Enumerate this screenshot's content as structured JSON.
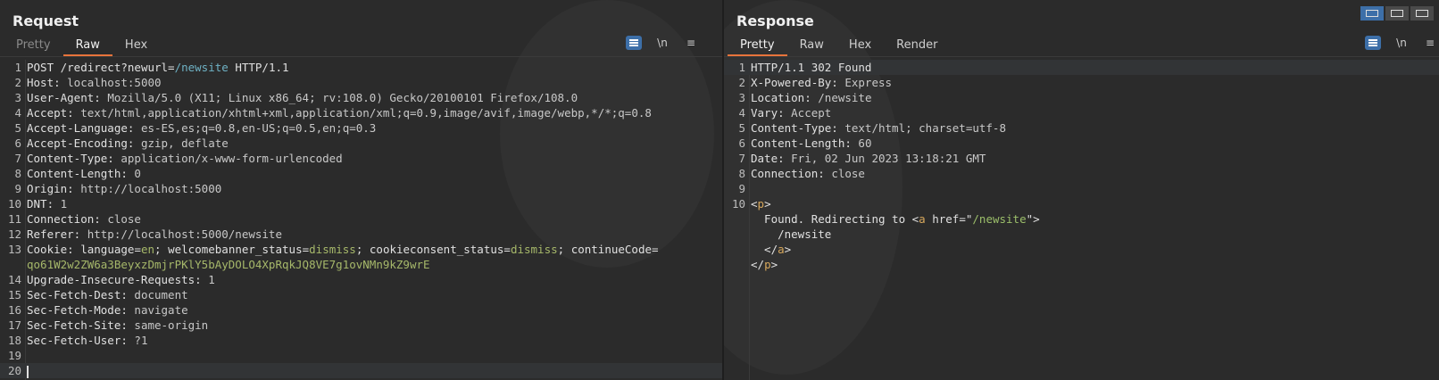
{
  "request": {
    "title": "Request",
    "tabs": [
      "Pretty",
      "Raw",
      "Hex"
    ],
    "active_tab": "Raw",
    "tools": {
      "newline_label": "\\n",
      "menu_label": "≡"
    },
    "lines": [
      {
        "n": "1",
        "parts": [
          {
            "t": "POST /redirect?",
            "c": "k"
          },
          {
            "t": "newurl",
            "c": "k"
          },
          {
            "t": "=",
            "c": "k"
          },
          {
            "t": "/newsite",
            "c": "p"
          },
          {
            "t": " HTTP/1.1",
            "c": "k"
          }
        ]
      },
      {
        "n": "2",
        "parts": [
          {
            "t": "Host: ",
            "c": "k"
          },
          {
            "t": "localhost:5000",
            "c": "v"
          }
        ]
      },
      {
        "n": "3",
        "parts": [
          {
            "t": "User-Agent: ",
            "c": "k"
          },
          {
            "t": "Mozilla/5.0 (X11; Linux x86_64; rv:108.0) Gecko/20100101 Firefox/108.0",
            "c": "v"
          }
        ]
      },
      {
        "n": "4",
        "parts": [
          {
            "t": "Accept: ",
            "c": "k"
          },
          {
            "t": "text/html,application/xhtml+xml,application/xml;q=0.9,image/avif,image/webp,*/*;q=0.8",
            "c": "v"
          }
        ]
      },
      {
        "n": "5",
        "parts": [
          {
            "t": "Accept-Language: ",
            "c": "k"
          },
          {
            "t": "es-ES,es;q=0.8,en-US;q=0.5,en;q=0.3",
            "c": "v"
          }
        ]
      },
      {
        "n": "6",
        "parts": [
          {
            "t": "Accept-Encoding: ",
            "c": "k"
          },
          {
            "t": "gzip, deflate",
            "c": "v"
          }
        ]
      },
      {
        "n": "7",
        "parts": [
          {
            "t": "Content-Type: ",
            "c": "k"
          },
          {
            "t": "application/x-www-form-urlencoded",
            "c": "v"
          }
        ]
      },
      {
        "n": "8",
        "parts": [
          {
            "t": "Content-Length: ",
            "c": "k"
          },
          {
            "t": "0",
            "c": "v"
          }
        ]
      },
      {
        "n": "9",
        "parts": [
          {
            "t": "Origin: ",
            "c": "k"
          },
          {
            "t": "http://localhost:5000",
            "c": "v"
          }
        ]
      },
      {
        "n": "10",
        "parts": [
          {
            "t": "DNT: ",
            "c": "k"
          },
          {
            "t": "1",
            "c": "v"
          }
        ]
      },
      {
        "n": "11",
        "parts": [
          {
            "t": "Connection: ",
            "c": "k"
          },
          {
            "t": "close",
            "c": "v"
          }
        ]
      },
      {
        "n": "12",
        "parts": [
          {
            "t": "Referer: ",
            "c": "k"
          },
          {
            "t": "http://localhost:5000/newsite",
            "c": "v"
          }
        ]
      },
      {
        "n": "13",
        "parts": [
          {
            "t": "Cookie: ",
            "c": "k"
          },
          {
            "t": "language",
            "c": "k"
          },
          {
            "t": "=",
            "c": "k"
          },
          {
            "t": "en",
            "c": "g"
          },
          {
            "t": "; ",
            "c": "k"
          },
          {
            "t": "welcomebanner_status",
            "c": "k"
          },
          {
            "t": "=",
            "c": "k"
          },
          {
            "t": "dismiss",
            "c": "g"
          },
          {
            "t": "; ",
            "c": "k"
          },
          {
            "t": "cookieconsent_status",
            "c": "k"
          },
          {
            "t": "=",
            "c": "k"
          },
          {
            "t": "dismiss",
            "c": "g"
          },
          {
            "t": "; ",
            "c": "k"
          },
          {
            "t": "continueCode",
            "c": "k"
          },
          {
            "t": "=",
            "c": "k"
          }
        ]
      },
      {
        "n": "",
        "parts": [
          {
            "t": "qo61W2w2ZW6a3BeyxzDmjrPKlY5bAyDOLO4XpRqkJQ8VE7g1ovNMn9kZ9wrE",
            "c": "g"
          }
        ]
      },
      {
        "n": "14",
        "parts": [
          {
            "t": "Upgrade-Insecure-Requests: ",
            "c": "k"
          },
          {
            "t": "1",
            "c": "v"
          }
        ]
      },
      {
        "n": "15",
        "parts": [
          {
            "t": "Sec-Fetch-Dest: ",
            "c": "k"
          },
          {
            "t": "document",
            "c": "v"
          }
        ]
      },
      {
        "n": "16",
        "parts": [
          {
            "t": "Sec-Fetch-Mode: ",
            "c": "k"
          },
          {
            "t": "navigate",
            "c": "v"
          }
        ]
      },
      {
        "n": "17",
        "parts": [
          {
            "t": "Sec-Fetch-Site: ",
            "c": "k"
          },
          {
            "t": "same-origin",
            "c": "v"
          }
        ]
      },
      {
        "n": "18",
        "parts": [
          {
            "t": "Sec-Fetch-User: ",
            "c": "k"
          },
          {
            "t": "?1",
            "c": "v"
          }
        ]
      },
      {
        "n": "19",
        "parts": []
      },
      {
        "n": "20",
        "parts": [],
        "cursor": true
      }
    ]
  },
  "response": {
    "title": "Response",
    "tabs": [
      "Pretty",
      "Raw",
      "Hex",
      "Render"
    ],
    "active_tab": "Pretty",
    "tools": {
      "newline_label": "\\n",
      "menu_label": "≡"
    },
    "lines": [
      {
        "n": "1",
        "parts": [
          {
            "t": "HTTP/1.1 302 Found",
            "c": "k"
          }
        ]
      },
      {
        "n": "2",
        "parts": [
          {
            "t": "X-Powered-By: ",
            "c": "k"
          },
          {
            "t": "Express",
            "c": "v"
          }
        ]
      },
      {
        "n": "3",
        "parts": [
          {
            "t": "Location: ",
            "c": "k"
          },
          {
            "t": "/newsite",
            "c": "v"
          }
        ]
      },
      {
        "n": "4",
        "parts": [
          {
            "t": "Vary: ",
            "c": "k"
          },
          {
            "t": "Accept",
            "c": "v"
          }
        ]
      },
      {
        "n": "5",
        "parts": [
          {
            "t": "Content-Type: ",
            "c": "k"
          },
          {
            "t": "text/html; charset=utf-8",
            "c": "v"
          }
        ]
      },
      {
        "n": "6",
        "parts": [
          {
            "t": "Content-Length: ",
            "c": "k"
          },
          {
            "t": "60",
            "c": "v"
          }
        ]
      },
      {
        "n": "7",
        "parts": [
          {
            "t": "Date: ",
            "c": "k"
          },
          {
            "t": "Fri, 02 Jun 2023 13:18:21 GMT",
            "c": "v"
          }
        ]
      },
      {
        "n": "8",
        "parts": [
          {
            "t": "Connection: ",
            "c": "k"
          },
          {
            "t": "close",
            "c": "v"
          }
        ]
      },
      {
        "n": "9",
        "parts": []
      },
      {
        "n": "10",
        "parts": [
          {
            "t": "<",
            "c": "k"
          },
          {
            "t": "p",
            "c": "o"
          },
          {
            "t": ">",
            "c": "k"
          }
        ]
      },
      {
        "n": "",
        "parts": [
          {
            "t": "  Found. Redirecting to ",
            "c": "k"
          },
          {
            "t": "<",
            "c": "k"
          },
          {
            "t": "a",
            "c": "o"
          },
          {
            "t": " href",
            "c": "k"
          },
          {
            "t": "=\"",
            "c": "k"
          },
          {
            "t": "/newsite",
            "c": "s"
          },
          {
            "t": "\">",
            "c": "k"
          }
        ]
      },
      {
        "n": "",
        "parts": [
          {
            "t": "    /newsite",
            "c": "k"
          }
        ]
      },
      {
        "n": "",
        "parts": [
          {
            "t": "  </",
            "c": "k"
          },
          {
            "t": "a",
            "c": "o"
          },
          {
            "t": ">",
            "c": "k"
          }
        ]
      },
      {
        "n": "",
        "parts": [
          {
            "t": "</",
            "c": "k"
          },
          {
            "t": "p",
            "c": "o"
          },
          {
            "t": ">",
            "c": "k"
          }
        ]
      }
    ]
  },
  "layout_switch": {
    "active_index": 0
  }
}
